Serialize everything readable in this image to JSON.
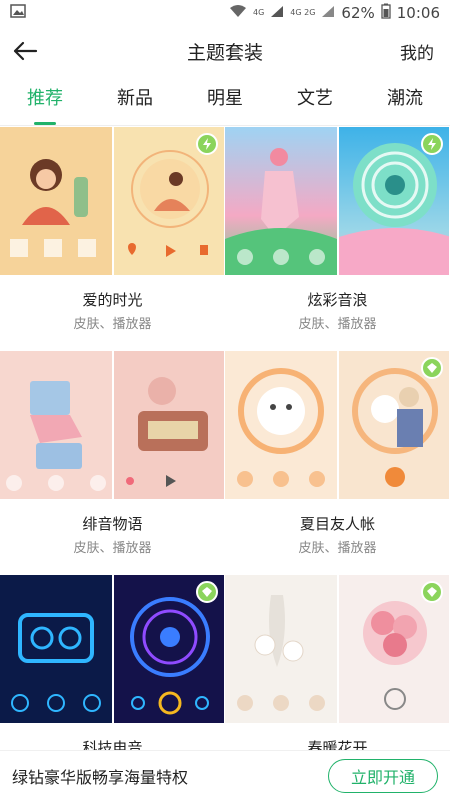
{
  "status": {
    "signal": "4G",
    "signal2": "4G 2G",
    "battery": "62%",
    "time": "10:06"
  },
  "header": {
    "title": "主题套装",
    "mine": "我的"
  },
  "tabs": [
    "推荐",
    "新品",
    "明星",
    "文艺",
    "潮流"
  ],
  "cards": [
    {
      "name": "爱的时光",
      "sub": "皮肤、播放器",
      "colors": [
        "#f6d39a",
        "#f8e2b0"
      ],
      "vip": true
    },
    {
      "name": "炫彩音浪",
      "sub": "皮肤、播放器",
      "colors": [
        "#8fc9f0",
        "#56b8e6"
      ],
      "vip": true
    },
    {
      "name": "绯音物语",
      "sub": "皮肤、播放器",
      "colors": [
        "#f7d7cf",
        "#f4ccc4"
      ],
      "vip": false
    },
    {
      "name": "夏目友人帐",
      "sub": "皮肤、播放器",
      "colors": [
        "#fbe9d5",
        "#f9e5cf"
      ],
      "vip": true
    },
    {
      "name": "科技电音",
      "sub": "",
      "colors": [
        "#0b1a48",
        "#14124a"
      ],
      "vip": true
    },
    {
      "name": "春暖花开",
      "sub": "",
      "colors": [
        "#f5f1ec",
        "#f7eeec"
      ],
      "vip": true
    }
  ],
  "bottom": {
    "promo": "绿钻豪华版畅享海量特权",
    "button": "立即开通"
  },
  "accent": "#21b26a"
}
